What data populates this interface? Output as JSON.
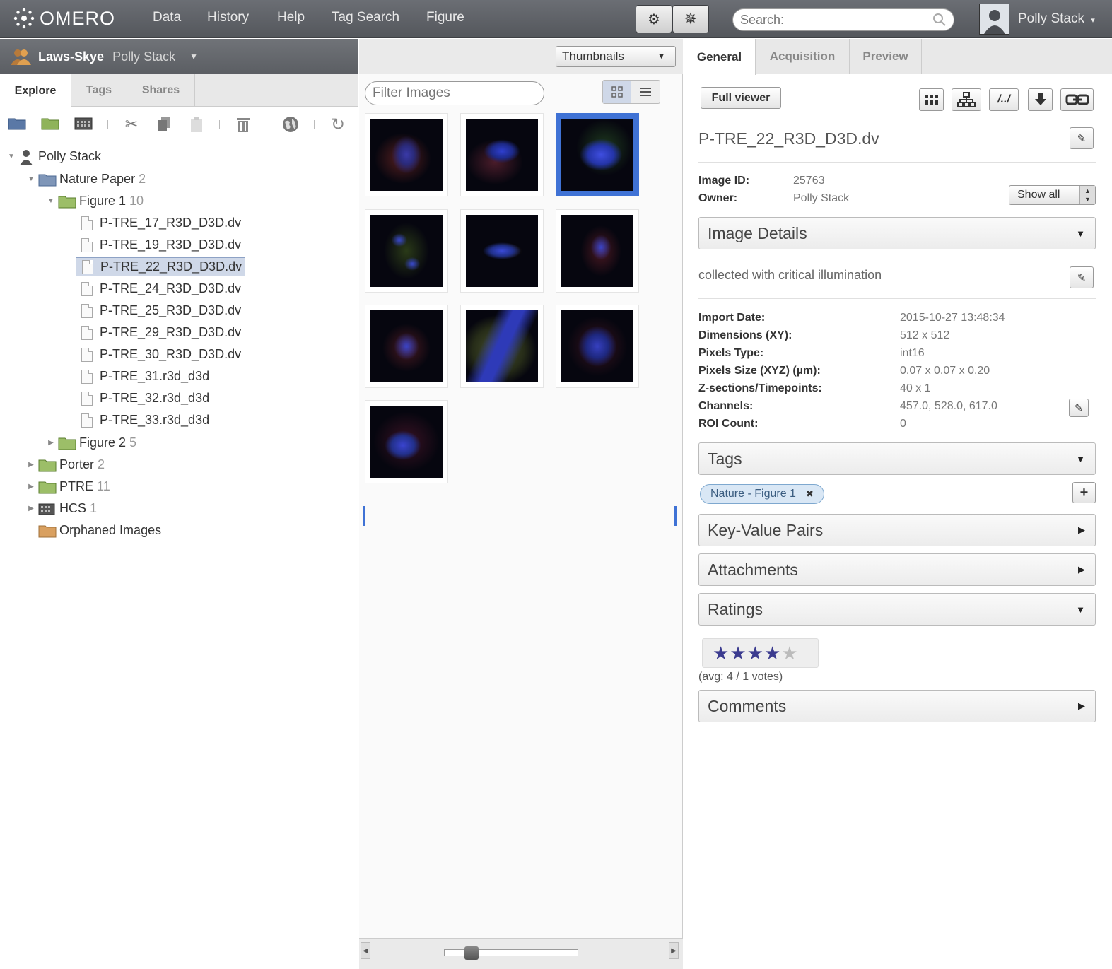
{
  "app": {
    "name": "OMERO"
  },
  "nav": [
    "Data",
    "History",
    "Help",
    "Tag Search",
    "Figure"
  ],
  "search": {
    "placeholder": "Search:"
  },
  "user": {
    "name": "Polly Stack"
  },
  "group": {
    "name": "Laws-Skye",
    "user": "Polly Stack"
  },
  "left_tabs": [
    "Explore",
    "Tags",
    "Shares"
  ],
  "tree": {
    "root": "Polly Stack",
    "project": {
      "name": "Nature Paper",
      "count": "2"
    },
    "dataset": {
      "name": "Figure 1",
      "count": "10"
    },
    "images": [
      "P-TRE_17_R3D_D3D.dv",
      "P-TRE_19_R3D_D3D.dv",
      "P-TRE_22_R3D_D3D.dv",
      "P-TRE_24_R3D_D3D.dv",
      "P-TRE_25_R3D_D3D.dv",
      "P-TRE_29_R3D_D3D.dv",
      "P-TRE_30_R3D_D3D.dv",
      "P-TRE_31.r3d_d3d",
      "P-TRE_32.r3d_d3d",
      "P-TRE_33.r3d_d3d"
    ],
    "figure2": {
      "name": "Figure 2",
      "count": "5"
    },
    "porter": {
      "name": "Porter",
      "count": "2"
    },
    "ptre": {
      "name": "PTRE",
      "count": "11"
    },
    "hcs": {
      "name": "HCS",
      "count": "1"
    },
    "orphaned": "Orphaned Images"
  },
  "center": {
    "view_select": "Thumbnails",
    "filter_placeholder": "Filter Images",
    "selected_thumbnail_index": 2
  },
  "right_tabs": [
    "General",
    "Acquisition",
    "Preview"
  ],
  "full_viewer": "Full viewer",
  "image": {
    "name": "P-TRE_22_R3D_D3D.dv",
    "id_label": "Image ID:",
    "id": "25763",
    "owner_label": "Owner:",
    "owner": "Polly Stack",
    "show_all": "Show all",
    "description": "collected with critical illumination"
  },
  "sections": {
    "details": "Image Details",
    "tags": "Tags",
    "kvp": "Key-Value Pairs",
    "attachments": "Attachments",
    "ratings": "Ratings",
    "comments": "Comments"
  },
  "details": [
    {
      "k": "Import Date:",
      "v": "2015-10-27 13:48:34"
    },
    {
      "k": "Dimensions (XY):",
      "v": "512 x 512"
    },
    {
      "k": "Pixels Type:",
      "v": "int16"
    },
    {
      "k": "Pixels Size (XYZ) (µm):",
      "v": "0.07 x 0.07 x 0.20"
    },
    {
      "k": "Z-sections/Timepoints:",
      "v": "40 x 1"
    },
    {
      "k": "Channels:",
      "v": "457.0, 528.0, 617.0"
    },
    {
      "k": "ROI Count:",
      "v": "0"
    }
  ],
  "tag": "Nature - Figure 1",
  "rating": {
    "stars": 4,
    "max": 5,
    "avg_text": "(avg: 4 / 1 votes)"
  },
  "colors": {
    "accent": "#3f72d5",
    "star": "#3b3b8f"
  }
}
